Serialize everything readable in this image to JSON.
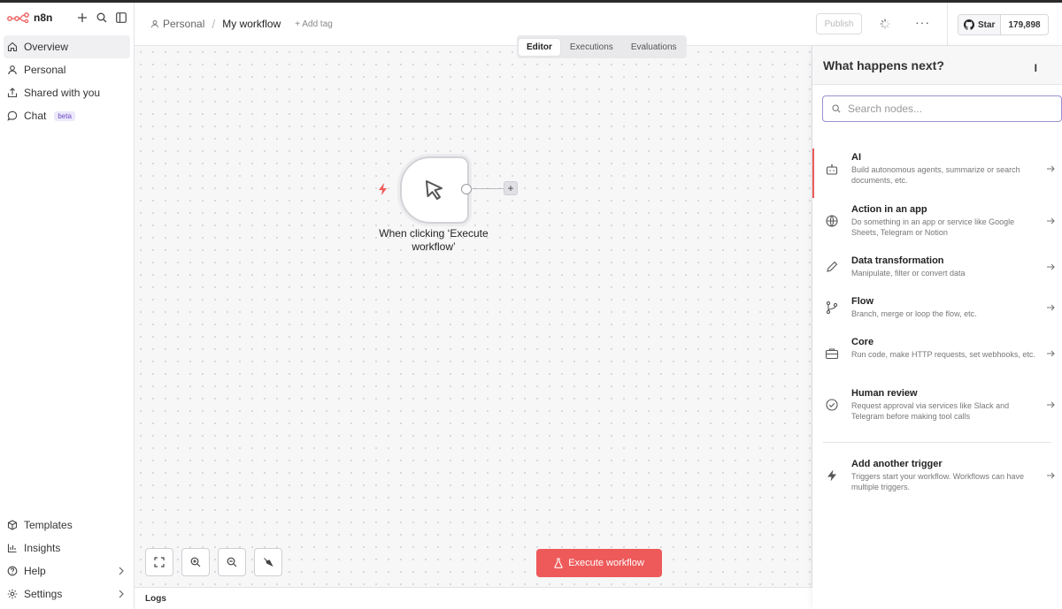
{
  "brand": {
    "name": "n8n",
    "accent": "#ee5a5a"
  },
  "sidebar": {
    "items": [
      {
        "label": "Overview",
        "icon": "home-icon"
      },
      {
        "label": "Personal",
        "icon": "user-icon"
      },
      {
        "label": "Shared with you",
        "icon": "share-icon"
      },
      {
        "label": "Chat",
        "icon": "chat-icon",
        "badge": "beta"
      }
    ],
    "bottom": [
      {
        "label": "Templates",
        "icon": "box-icon"
      },
      {
        "label": "Insights",
        "icon": "chart-icon"
      },
      {
        "label": "Help",
        "icon": "help-icon"
      },
      {
        "label": "Settings",
        "icon": "gear-icon"
      }
    ]
  },
  "header": {
    "crumb_personal": "Personal",
    "crumb_sep": "/",
    "title": "My workflow",
    "add_tag": "+ Add tag",
    "publish": "Publish",
    "more": "···",
    "github_star": "Star",
    "github_count": "179,898"
  },
  "tabs": [
    "Editor",
    "Executions",
    "Evaluations"
  ],
  "node": {
    "label": "When clicking ‘Execute workflow’",
    "add": "+"
  },
  "execute_button": "Execute workflow",
  "logs": "Logs",
  "panel": {
    "title": "What happens next?",
    "search_placeholder": "Search nodes...",
    "categories": [
      {
        "title": "AI",
        "desc": "Build autonomous agents, summarize or search documents, etc."
      },
      {
        "title": "Action in an app",
        "desc": "Do something in an app or service like Google Sheets, Telegram or Notion"
      },
      {
        "title": "Data transformation",
        "desc": "Manipulate, filter or convert data"
      },
      {
        "title": "Flow",
        "desc": "Branch, merge or loop the flow, etc."
      },
      {
        "title": "Core",
        "desc": "Run code, make HTTP requests, set webhooks, etc."
      },
      {
        "title": "Human review",
        "desc": "Request approval via services like Slack and Telegram before making tool calls"
      }
    ],
    "trigger": {
      "title": "Add another trigger",
      "desc": "Triggers start your workflow. Workflows can have multiple triggers."
    }
  }
}
